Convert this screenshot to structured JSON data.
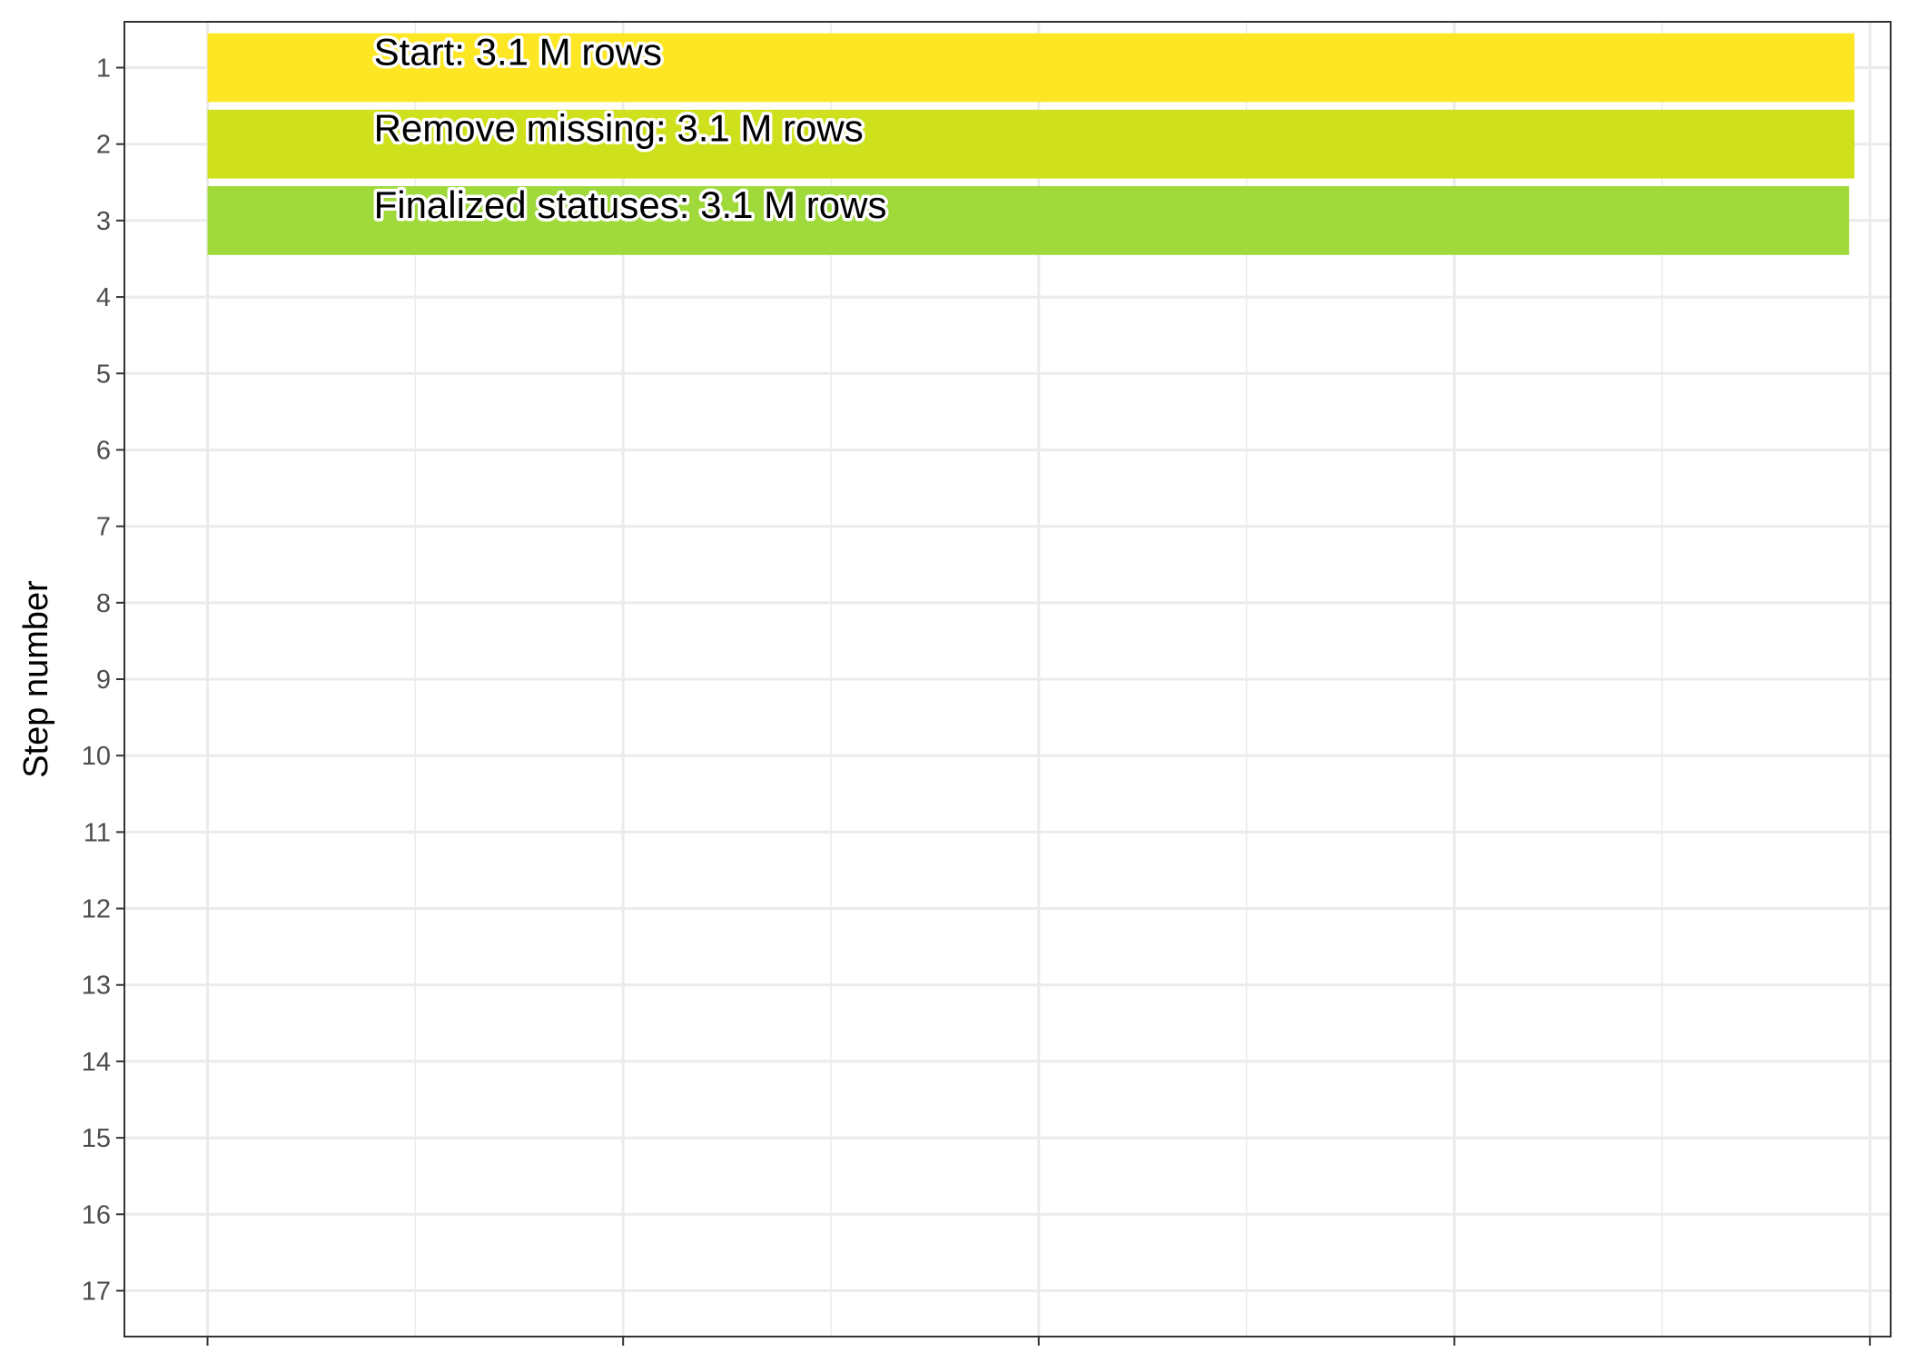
{
  "chart_data": {
    "type": "bar",
    "orientation": "horizontal",
    "ylabel": "Step number",
    "xlabel": "",
    "y_ticks": [
      1,
      2,
      3,
      4,
      5,
      6,
      7,
      8,
      9,
      10,
      11,
      12,
      13,
      14,
      15,
      16,
      17
    ],
    "ylim": [
      0.4,
      17.6
    ],
    "xlim": [
      -0.2,
      4.05
    ],
    "x_ticks": [
      0,
      1,
      2,
      3,
      4
    ],
    "x_tick_labels_visible": false,
    "grid": true,
    "bars": [
      {
        "step": 1,
        "label": "Start:  3.1 M rows",
        "value": 3.963,
        "color": "#FDE725"
      },
      {
        "step": 2,
        "label": "Remove missing:  3.1 M rows",
        "value": 3.963,
        "color": "#CFE11C"
      },
      {
        "step": 3,
        "label": "Finalized statuses:  3.1 M rows",
        "value": 3.95,
        "color": "#9FDA3A"
      }
    ]
  }
}
